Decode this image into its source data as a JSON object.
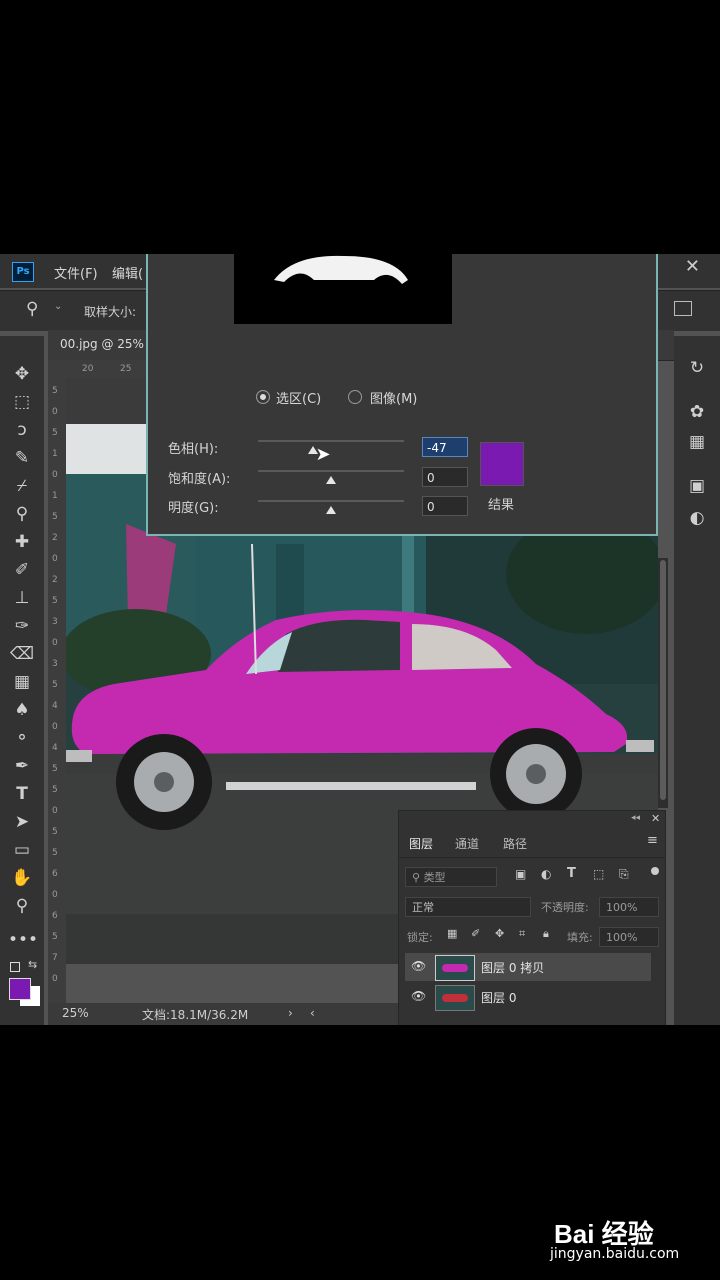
{
  "menubar": {
    "logo": "Ps",
    "menus": [
      "文件(F)",
      "编辑("
    ],
    "close": "✕"
  },
  "options_bar": {
    "sample_size_label": "取样大小:"
  },
  "document_tab": {
    "title": "00.jpg @ 25%"
  },
  "ruler": {
    "top_marks": [
      "20",
      "25"
    ],
    "left_marks": [
      "5",
      "0",
      "5",
      "1",
      "0",
      "1",
      "5",
      "2",
      "0",
      "2",
      "5",
      "3",
      "0",
      "3",
      "5",
      "4",
      "0",
      "4",
      "5",
      "5",
      "0",
      "5",
      "5",
      "6",
      "0",
      "6",
      "5",
      "7",
      "0"
    ]
  },
  "dialog": {
    "radio_selection": "选区(C)",
    "radio_image": "图像(M)",
    "hue_label": "色相(H):",
    "hue_value": "-47",
    "saturation_label": "饱和度(A):",
    "saturation_value": "0",
    "lightness_label": "明度(G):",
    "lightness_value": "0",
    "result_label": "结果",
    "result_color": "#7a1ab0",
    "hue_level": 0.38,
    "saturation_level": 0.5,
    "lightness_level": 0.5
  },
  "status": {
    "zoom": "25%",
    "doc_info": "文档:18.1M/36.2M"
  },
  "layers_panel": {
    "tabs": [
      "图层",
      "通道",
      "路径"
    ],
    "filter_placeholder": "类型",
    "blend_mode": "正常",
    "opacity_label": "不透明度:",
    "opacity_value": "100%",
    "lock_label": "锁定:",
    "fill_label": "填充:",
    "fill_value": "100%",
    "layers": [
      {
        "name": "图层 0 拷贝",
        "selected": true
      },
      {
        "name": "图层 0",
        "selected": false
      }
    ]
  },
  "colors": {
    "foreground": "#7a1ab0",
    "car": "#c42ab0"
  },
  "watermark": {
    "brand": "Bai 经验",
    "url": "jingyan.baidu.com"
  }
}
